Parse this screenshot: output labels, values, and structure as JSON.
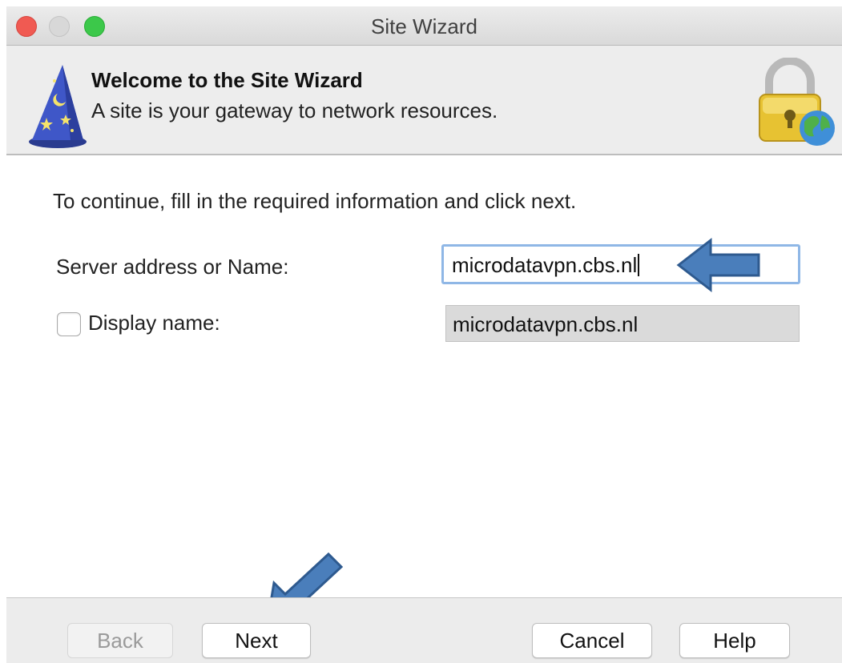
{
  "window": {
    "title": "Site Wizard"
  },
  "banner": {
    "title": "Welcome to the Site Wizard",
    "subtitle": "A site is your gateway to network resources.",
    "left_icon": "wizard-hat-icon",
    "right_icon": "lock-globe-icon"
  },
  "form": {
    "instruction": "To continue, fill in the required information and click next.",
    "server_label": "Server address or Name:",
    "server_value": "microdatavpn.cbs.nl",
    "display_label": "Display name:",
    "display_checked": false,
    "display_value": "microdatavpn.cbs.nl"
  },
  "footer": {
    "back_label": "Back",
    "next_label": "Next",
    "cancel_label": "Cancel",
    "help_label": "Help"
  },
  "colors": {
    "arrow_fill": "#4a7ebb",
    "arrow_stroke": "#2e5a8f",
    "focus_ring": "#8fb7e6",
    "close": "#f05a52",
    "zoom": "#3cc84a"
  }
}
